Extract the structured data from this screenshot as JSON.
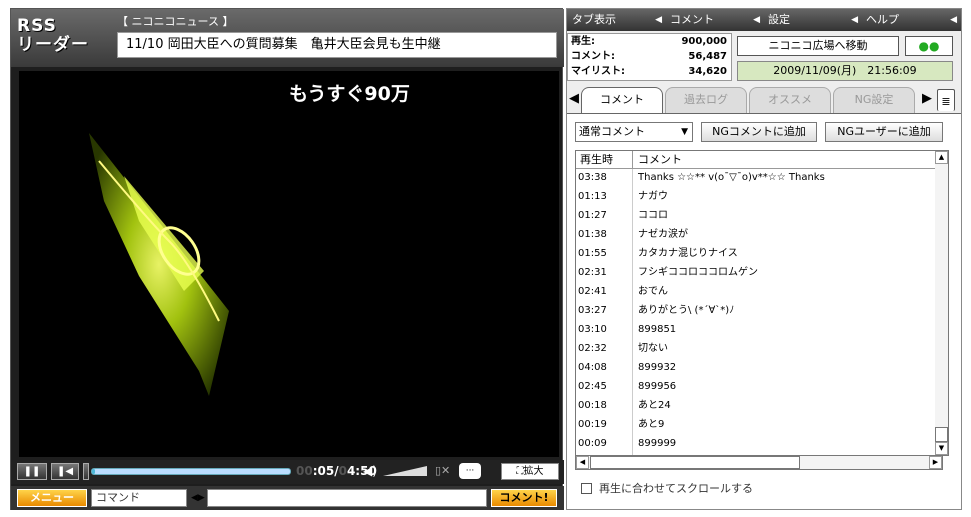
{
  "player": {
    "logo_line1": "RSS",
    "logo_line2": "リーダー",
    "channel": "【 ニコニコニュース 】",
    "title": "11/10 岡田大臣への質問募集　亀井大臣会見も生中継",
    "overlay_comment": "もうすぐ90万",
    "time_current_dim": "00",
    "time_current": ":05/",
    "time_total_dim": "0",
    "time_total": "4:50",
    "zoom_label": "拡大",
    "menu_label": "メニュー",
    "command_placeholder": "コマンド",
    "post_label": "コメント!",
    "seek_progress": 0.015
  },
  "panel": {
    "top_tabs": [
      {
        "label": "タブ表示"
      },
      {
        "label": "コメント"
      },
      {
        "label": "設定"
      },
      {
        "label": "ヘルプ"
      }
    ],
    "stats": {
      "play_label": "再生:",
      "play_value": "900,000",
      "comment_label": "コメント:",
      "comment_value": "56,487",
      "mylist_label": "マイリスト:",
      "mylist_value": "34,620"
    },
    "hiroba_label": "ニコニコ広場へ移動",
    "date": "2009/11/09(月)　21:56:09",
    "tabs": [
      {
        "label": "コメント"
      },
      {
        "label": "過去ログ"
      },
      {
        "label": "オススメ"
      },
      {
        "label": "NG設定"
      }
    ],
    "comment_type": "通常コメント",
    "ng_comment_button": "NGコメントに追加",
    "ng_user_button": "NGユーザーに追加",
    "list_header": {
      "time": "再生時",
      "comment": "コメント"
    },
    "comments": [
      {
        "time": "03:38",
        "text": "Thanks ☆☆** v(o¯▽¯o)v**☆☆ Thanks"
      },
      {
        "time": "01:13",
        "text": "ナガウ"
      },
      {
        "time": "01:27",
        "text": "ココロ"
      },
      {
        "time": "01:38",
        "text": "ナゼカ涙が"
      },
      {
        "time": "01:55",
        "text": "カタカナ混じりナイス"
      },
      {
        "time": "02:31",
        "text": "フシギココロココロムゲン"
      },
      {
        "time": "02:41",
        "text": "おでん"
      },
      {
        "time": "03:27",
        "text": "ありがとう\\ (*´∀`*)ﾉ"
      },
      {
        "time": "03:10",
        "text": "899851"
      },
      {
        "time": "02:32",
        "text": "切ない"
      },
      {
        "time": "04:08",
        "text": "899932"
      },
      {
        "time": "02:45",
        "text": "899956"
      },
      {
        "time": "00:18",
        "text": "あと24"
      },
      {
        "time": "00:19",
        "text": "あと9"
      },
      {
        "time": "00:09",
        "text": "899999"
      }
    ],
    "sync_label": "再生に合わせてスクロールする"
  }
}
